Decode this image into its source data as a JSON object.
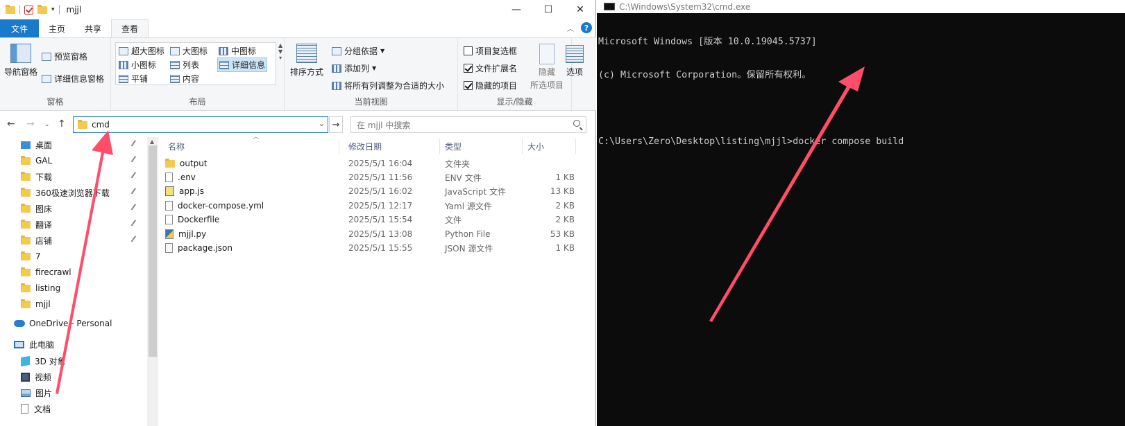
{
  "explorer": {
    "window_title": "mjjl",
    "window_controls": {
      "minimize": "—",
      "maximize": "☐",
      "close": "✕"
    },
    "tabs": [
      {
        "label": "文件",
        "kind": "file"
      },
      {
        "label": "主页",
        "kind": "normal"
      },
      {
        "label": "共享",
        "kind": "normal"
      },
      {
        "label": "查看",
        "kind": "active"
      }
    ],
    "help_label": "?",
    "ribbon": {
      "pane_group": {
        "nav_pane": "导航窗格",
        "preview_pane": "预览窗格",
        "details_pane": "详细信息窗格",
        "label": "窗格"
      },
      "layout_group": {
        "items": [
          "超大图标",
          "大图标",
          "中图标",
          "小图标",
          "列表",
          "详细信息",
          "平铺",
          "内容"
        ],
        "selected": "详细信息",
        "label": "布局"
      },
      "current_view_group": {
        "sort_by": "排序方式",
        "group_by": "分组依据",
        "add_column": "添加列",
        "fit_columns": "将所有列调整为合适的大小",
        "label": "当前视图"
      },
      "show_hide_group": {
        "item_checkbox": "项目复选框",
        "file_ext": "文件扩展名",
        "hidden_items": "隐藏的项目",
        "hide_selected_line1": "隐藏",
        "hide_selected_line2": "所选项目",
        "label": "显示/隐藏",
        "checked": {
          "item_checkbox": false,
          "file_ext": true,
          "hidden_items": true
        }
      },
      "options_label": "选项"
    },
    "address": {
      "value": "cmd",
      "search_placeholder": "在 mjjl 中搜索"
    },
    "nav_items": [
      {
        "label": "桌面",
        "icon": "desktop-icon",
        "pinned": true
      },
      {
        "label": "GAL",
        "icon": "folder-icon",
        "pinned": true
      },
      {
        "label": "下载",
        "icon": "folder-icon",
        "pinned": true
      },
      {
        "label": "360极速浏览器下载",
        "icon": "folder-icon",
        "pinned": true
      },
      {
        "label": "图床",
        "icon": "folder-icon",
        "pinned": true
      },
      {
        "label": "翻译",
        "icon": "folder-icon",
        "pinned": true
      },
      {
        "label": "店铺",
        "icon": "folder-icon",
        "pinned": true
      },
      {
        "label": "7",
        "icon": "folder-icon",
        "pinned": false
      },
      {
        "label": "firecrawl",
        "icon": "folder-icon",
        "pinned": false
      },
      {
        "label": "listing",
        "icon": "folder-icon",
        "pinned": false
      },
      {
        "label": "mjjl",
        "icon": "folder-icon",
        "pinned": false
      }
    ],
    "onedrive_label": "OneDrive - Personal",
    "thispc_label": "此电脑",
    "pc_items": [
      {
        "label": "3D 对象",
        "icon": "cube-icon"
      },
      {
        "label": "视频",
        "icon": "video-icon"
      },
      {
        "label": "图片",
        "icon": "picture-icon"
      },
      {
        "label": "文档",
        "icon": "document-icon"
      }
    ],
    "columns": {
      "name": "名称",
      "date": "修改日期",
      "type": "类型",
      "size": "大小"
    },
    "files": [
      {
        "name": "output",
        "date": "2025/5/1 16:04",
        "type": "文件夹",
        "size": "",
        "icon": "folder-icon"
      },
      {
        "name": ".env",
        "date": "2025/5/1 11:56",
        "type": "ENV 文件",
        "size": "1 KB",
        "icon": "file-icon"
      },
      {
        "name": "app.js",
        "date": "2025/5/1 16:02",
        "type": "JavaScript 文件",
        "size": "13 KB",
        "icon": "js-file-icon"
      },
      {
        "name": "docker-compose.yml",
        "date": "2025/5/1 12:17",
        "type": "Yaml 源文件",
        "size": "2 KB",
        "icon": "yaml-file-icon"
      },
      {
        "name": "Dockerfile",
        "date": "2025/5/1 15:54",
        "type": "文件",
        "size": "2 KB",
        "icon": "file-icon"
      },
      {
        "name": "mjjl.py",
        "date": "2025/5/1 13:08",
        "type": "Python File",
        "size": "53 KB",
        "icon": "python-file-icon"
      },
      {
        "name": "package.json",
        "date": "2025/5/1 15:55",
        "type": "JSON 源文件",
        "size": "1 KB",
        "icon": "json-file-icon"
      }
    ]
  },
  "cmd": {
    "title": "C:\\Windows\\System32\\cmd.exe",
    "lines": [
      "Microsoft Windows [版本 10.0.19045.5737]",
      "(c) Microsoft Corporation。保留所有权利。",
      "",
      "C:\\Users\\Zero\\Desktop\\listing\\mjjl>docker compose build"
    ]
  },
  "colors": {
    "accent": "#1979ca",
    "annotation_arrow": "#ff4d6a",
    "console_bg": "#0c0c0c",
    "console_fg": "#cccccc"
  }
}
